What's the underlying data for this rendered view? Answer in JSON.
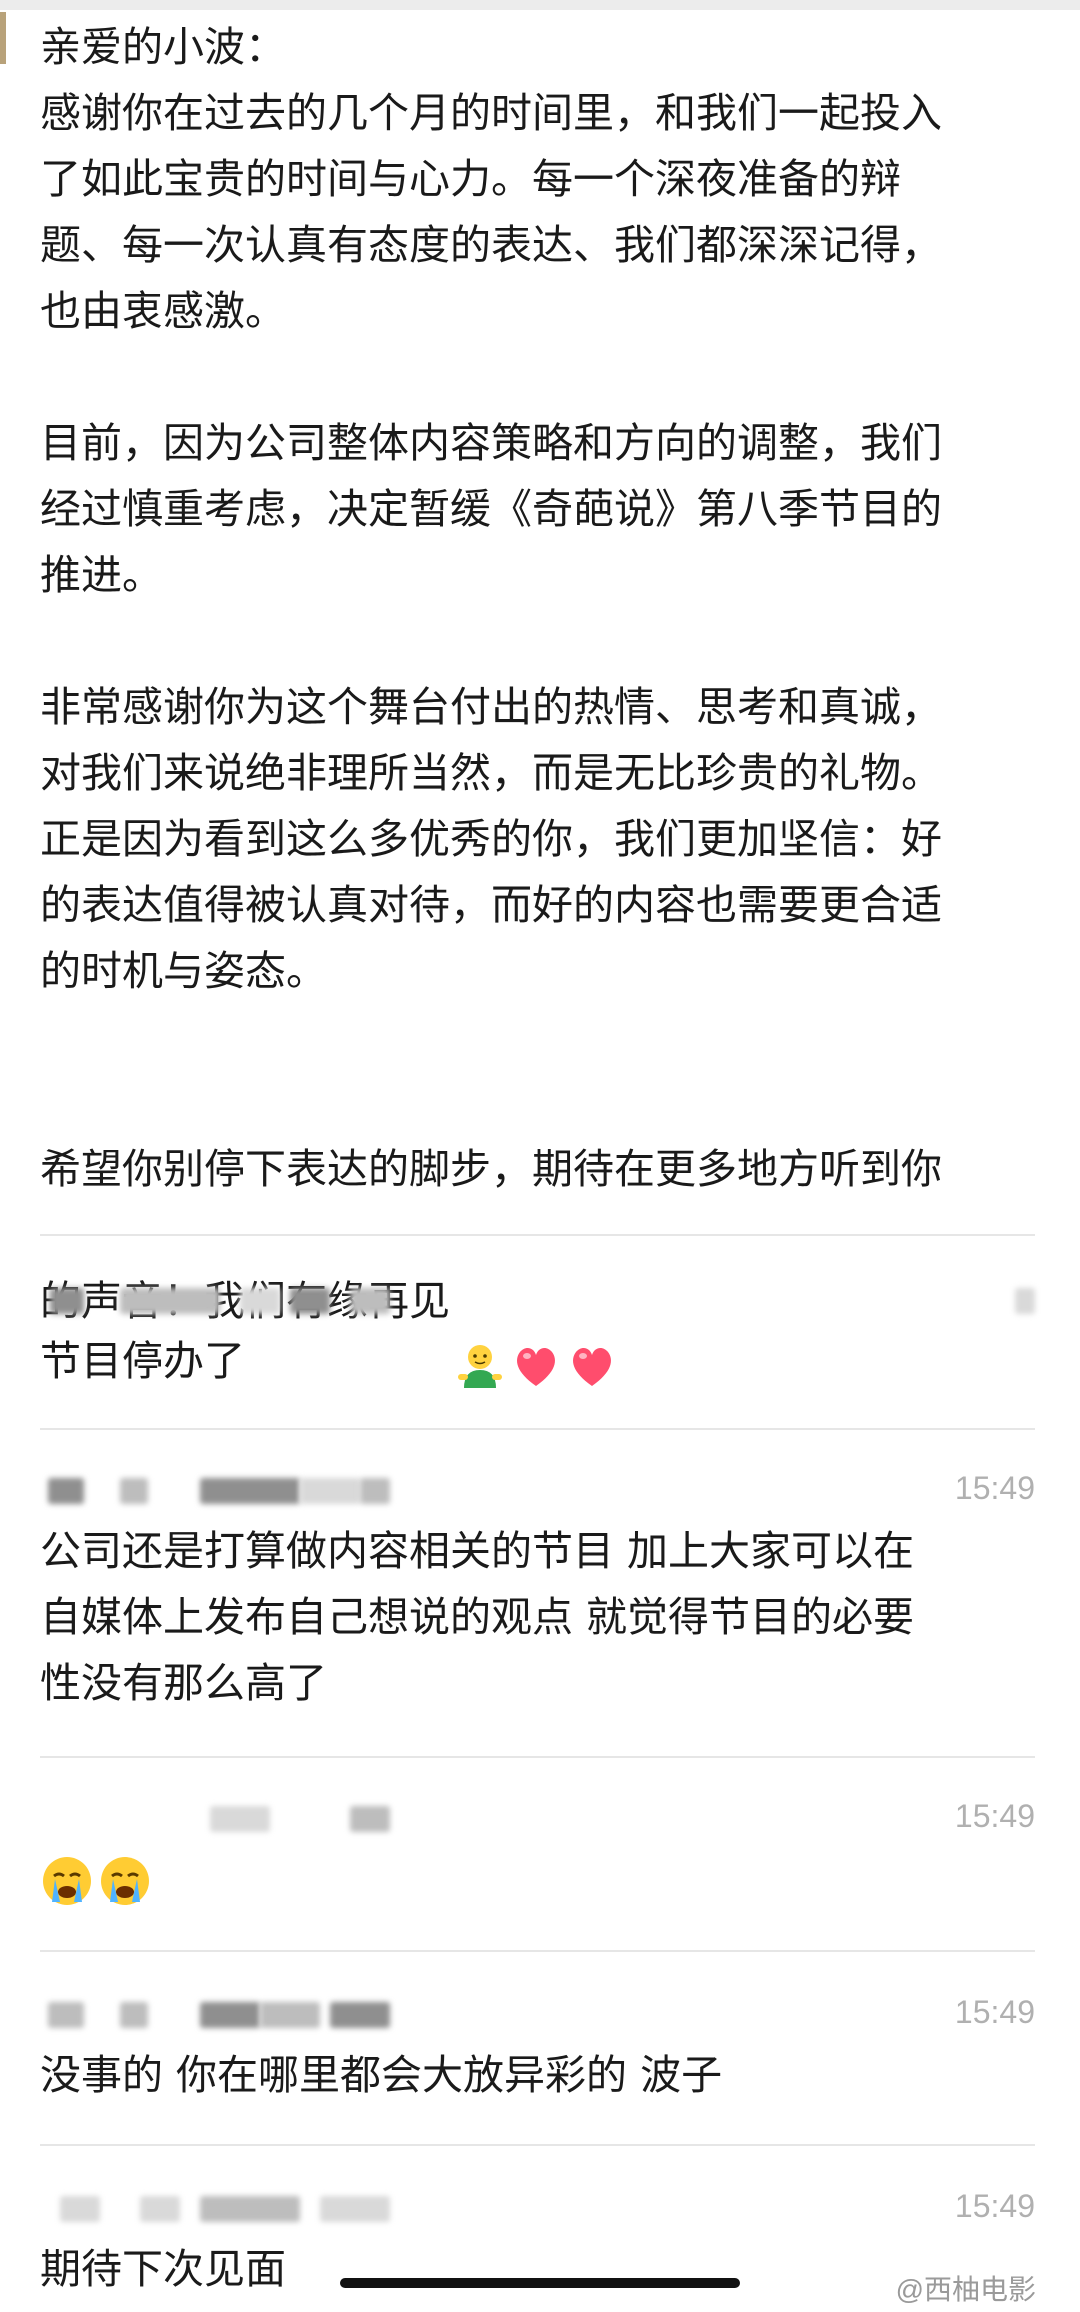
{
  "letter": {
    "paragraphs": [
      "亲爱的小波：\n感谢你在过去的几个月的时间里，和我们一起投入\n了如此宝贵的时间与心力。每一个深夜准备的辩\n题、每一次认真有态度的表达、我们都深深记得，\n也由衷感激。",
      "目前，因为公司整体内容策略和方向的调整，我们\n经过慎重考虑，决定暂缓《奇葩说》第八季节目的\n推进。",
      "非常感谢你为这个舞台付出的热情、思考和真诚，\n对我们来说绝非理所当然，而是无比珍贵的礼物。\n正是因为看到这么多优秀的你，我们更加坚信：好\n的表达值得被认真对待，而好的内容也需要更合适\n的时机与姿态。"
    ],
    "closing_line_1": "希望你别停下表达的脚步，期待在更多地方听到你",
    "closing_line_2": "的声音！我们有缘再见",
    "closing_emojis": [
      "person-emoji",
      "heart-emoji",
      "heart-emoji"
    ]
  },
  "comments": [
    {
      "time": "",
      "text": "节目停办了"
    },
    {
      "time": "15:49",
      "text": "公司还是打算做内容相关的节目 加上大家可以在\n自媒体上发布自己想说的观点 就觉得节目的必要\n性没有那么高了"
    },
    {
      "time": "15:49",
      "text": "",
      "emojis": [
        "crying-face-emoji",
        "crying-face-emoji"
      ]
    },
    {
      "time": "15:49",
      "text": "没事的 你在哪里都会大放异彩的 波子"
    },
    {
      "time": "15:49",
      "text": "期待下次见面"
    }
  ],
  "watermark": "@西柚电影",
  "colors": {
    "text": "#1a1a1a",
    "timestamp": "#b0b0b0",
    "divider": "#e6e6e6",
    "heart": "#ff4d6d"
  }
}
